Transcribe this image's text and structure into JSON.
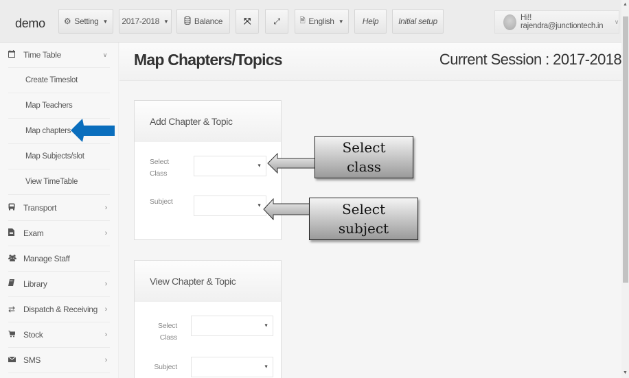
{
  "header": {
    "brand": "demo",
    "buttons": {
      "setting": "Setting",
      "session": "2017-2018",
      "balance": "Balance",
      "language": "English",
      "help": "Help",
      "initial_setup": "Initial setup"
    },
    "user_greeting": "Hi!! rajendra@junctiontech.in"
  },
  "sidebar": {
    "items": [
      {
        "label": "Time Table",
        "icon": "calendar-icon",
        "expanded": true
      },
      {
        "label": "Transport",
        "icon": "bus-icon"
      },
      {
        "label": "Exam",
        "icon": "file-icon"
      },
      {
        "label": "Manage Staff",
        "icon": "users-icon"
      },
      {
        "label": "Library",
        "icon": "book-icon"
      },
      {
        "label": "Dispatch & Receiving",
        "icon": "exchange-icon"
      },
      {
        "label": "Stock",
        "icon": "cart-icon"
      },
      {
        "label": "SMS",
        "icon": "envelope-icon"
      }
    ],
    "timetable_subitems": [
      "Create Timeslot",
      "Map Teachers",
      "Map chapters",
      "Map Subjects/slot",
      "View TimeTable"
    ],
    "highlight_color": "#0a6ebd"
  },
  "page": {
    "title": "Map Chapters/Topics",
    "session": "Current Session : 2017-2018"
  },
  "add_panel": {
    "title": "Add Chapter & Topic",
    "class_label_1": "Select",
    "class_label_2": "Class",
    "subject_label": "Subject",
    "class_value": "",
    "subject_value": ""
  },
  "view_panel": {
    "title": "View Chapter & Topic",
    "class_label_1": "Select",
    "class_label_2": "Class",
    "subject_label": "Subject",
    "class_value": "",
    "subject_value": ""
  },
  "annotations": {
    "select_class_1": "Select",
    "select_class_2": "class",
    "select_subject_1": "Select",
    "select_subject_2": "subject"
  }
}
